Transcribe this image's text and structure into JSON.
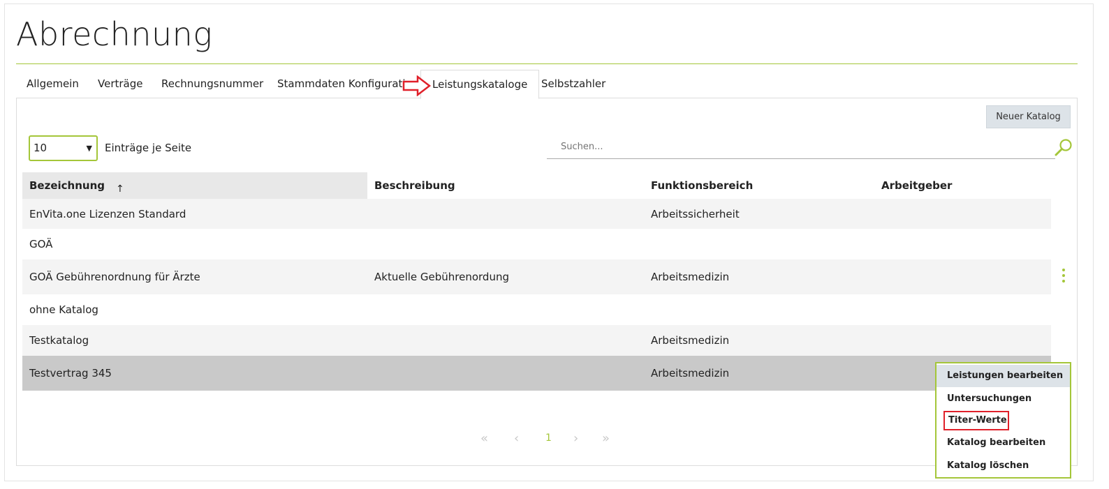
{
  "page": {
    "title": "Abrechnung"
  },
  "tabs": [
    {
      "label": "Allgemein",
      "active": false
    },
    {
      "label": "Verträge",
      "active": false
    },
    {
      "label": "Rechnungsnummer",
      "active": false
    },
    {
      "label": "Stammdaten Konfiguration",
      "active": false
    },
    {
      "label": "Leistungskataloge",
      "active": true
    },
    {
      "label": "Selbstzahler",
      "active": false
    }
  ],
  "toolbar": {
    "new_catalog_label": "Neuer Katalog"
  },
  "paging": {
    "page_size": "10",
    "page_size_label": "Einträge je Seite",
    "first": "«",
    "prev": "‹",
    "current": "1",
    "next": "›",
    "last": "»"
  },
  "search": {
    "placeholder": "Suchen..."
  },
  "table": {
    "columns": [
      "Bezeichnung",
      "Beschreibung",
      "Funktionsbereich",
      "Arbeitgeber"
    ],
    "sort_indicator": "↑",
    "rows": [
      [
        "EnVita.one Lizenzen Standard",
        "",
        "Arbeitssicherheit",
        ""
      ],
      [
        "GOÄ",
        "",
        "",
        ""
      ],
      [
        "GOÄ Gebührenordnung für Ärzte",
        "Aktuelle Gebührenordung",
        "Arbeitsmedizin",
        ""
      ],
      [
        "ohne Katalog",
        "",
        "",
        ""
      ],
      [
        "Testkatalog",
        "",
        "Arbeitsmedizin",
        ""
      ],
      [
        "Testvertrag 345",
        "",
        "Arbeitsmedizin",
        ""
      ]
    ]
  },
  "context_menu": {
    "items": [
      "Leistungen bearbeiten",
      "Untersuchungen",
      "Titer-Werte",
      "Katalog bearbeiten",
      "Katalog löschen"
    ]
  },
  "colors": {
    "accent": "#a4c639",
    "annotation_red": "#e0202a",
    "selected_row": "#c9c9c9",
    "button_bg": "#dde3e8"
  },
  "icons": {
    "search": "search-icon",
    "row_menu": "kebab-menu-icon",
    "annotation": "red-arrow-icon"
  }
}
